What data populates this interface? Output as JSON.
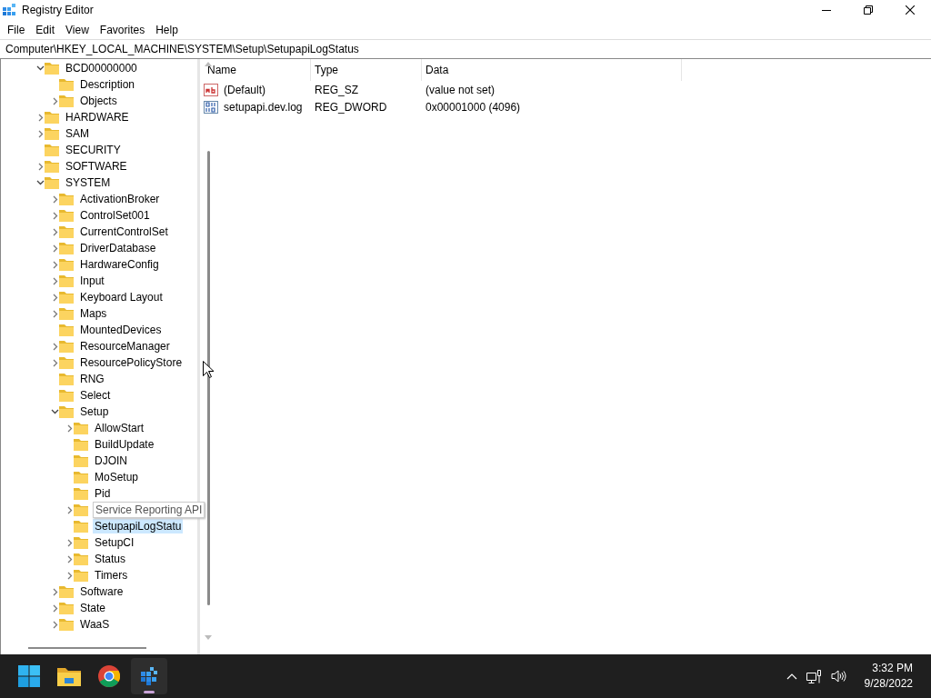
{
  "window": {
    "title": "Registry Editor"
  },
  "menu": [
    "File",
    "Edit",
    "View",
    "Favorites",
    "Help"
  ],
  "address": "Computer\\HKEY_LOCAL_MACHINE\\SYSTEM\\Setup\\SetupapiLogStatus",
  "tree": [
    {
      "label": "BCD00000000",
      "kind": "expanded",
      "selected": false,
      "hovered": false,
      "children": [
        {
          "label": "Description",
          "kind": "leaf",
          "selected": false,
          "hovered": false
        },
        {
          "label": "Objects",
          "kind": "collapsed",
          "selected": false,
          "hovered": false
        }
      ]
    },
    {
      "label": "HARDWARE",
      "kind": "collapsed",
      "selected": false,
      "hovered": false
    },
    {
      "label": "SAM",
      "kind": "collapsed",
      "selected": false,
      "hovered": false
    },
    {
      "label": "SECURITY",
      "kind": "leaf",
      "selected": false,
      "hovered": false
    },
    {
      "label": "SOFTWARE",
      "kind": "collapsed",
      "selected": false,
      "hovered": false
    },
    {
      "label": "SYSTEM",
      "kind": "expanded",
      "selected": false,
      "hovered": false,
      "children": [
        {
          "label": "ActivationBroker",
          "kind": "collapsed",
          "selected": false,
          "hovered": false
        },
        {
          "label": "ControlSet001",
          "kind": "collapsed",
          "selected": false,
          "hovered": false
        },
        {
          "label": "CurrentControlSet",
          "kind": "collapsed",
          "selected": false,
          "hovered": false
        },
        {
          "label": "DriverDatabase",
          "kind": "collapsed",
          "selected": false,
          "hovered": false
        },
        {
          "label": "HardwareConfig",
          "kind": "collapsed",
          "selected": false,
          "hovered": false
        },
        {
          "label": "Input",
          "kind": "collapsed",
          "selected": false,
          "hovered": false
        },
        {
          "label": "Keyboard Layout",
          "kind": "collapsed",
          "selected": false,
          "hovered": false
        },
        {
          "label": "Maps",
          "kind": "collapsed",
          "selected": false,
          "hovered": false
        },
        {
          "label": "MountedDevices",
          "kind": "leaf",
          "selected": false,
          "hovered": false
        },
        {
          "label": "ResourceManager",
          "kind": "collapsed",
          "selected": false,
          "hovered": false
        },
        {
          "label": "ResourcePolicyStore",
          "kind": "collapsed",
          "selected": false,
          "hovered": false
        },
        {
          "label": "RNG",
          "kind": "leaf",
          "selected": false,
          "hovered": false
        },
        {
          "label": "Select",
          "kind": "leaf",
          "selected": false,
          "hovered": false
        },
        {
          "label": "Setup",
          "kind": "expanded",
          "selected": false,
          "hovered": false,
          "children": [
            {
              "label": "AllowStart",
              "kind": "collapsed",
              "selected": false,
              "hovered": false
            },
            {
              "label": "BuildUpdate",
              "kind": "leaf",
              "selected": false,
              "hovered": false
            },
            {
              "label": "DJOIN",
              "kind": "leaf",
              "selected": false,
              "hovered": false
            },
            {
              "label": "MoSetup",
              "kind": "leaf",
              "selected": false,
              "hovered": false
            },
            {
              "label": "Pid",
              "kind": "leaf",
              "selected": false,
              "hovered": false
            },
            {
              "label": "Service Reporting API",
              "kind": "collapsed",
              "selected": false,
              "hovered": true
            },
            {
              "label": "SetupapiLogStatu",
              "kind": "leaf",
              "selected": true,
              "hovered": false
            },
            {
              "label": "SetupCI",
              "kind": "collapsed",
              "selected": false,
              "hovered": false
            },
            {
              "label": "Status",
              "kind": "collapsed",
              "selected": false,
              "hovered": false
            },
            {
              "label": "Timers",
              "kind": "collapsed",
              "selected": false,
              "hovered": false
            }
          ]
        },
        {
          "label": "Software",
          "kind": "collapsed",
          "selected": false,
          "hovered": false
        },
        {
          "label": "State",
          "kind": "collapsed",
          "selected": false,
          "hovered": false
        },
        {
          "label": "WaaS",
          "kind": "collapsed",
          "selected": false,
          "hovered": false
        }
      ]
    }
  ],
  "values": {
    "columns": [
      "Name",
      "Type",
      "Data"
    ],
    "rows": [
      {
        "kind": "string",
        "name": "(Default)",
        "type": "REG_SZ",
        "data": "(value not set)"
      },
      {
        "kind": "binary",
        "name": "setupapi.dev.log",
        "type": "REG_DWORD",
        "data": "0x00001000 (4096)"
      }
    ]
  },
  "taskbar": {
    "apps": [
      {
        "kind": "start",
        "active": false
      },
      {
        "kind": "explorer",
        "active": false
      },
      {
        "kind": "browser",
        "active": false
      },
      {
        "kind": "registry",
        "active": true
      }
    ],
    "time": "3:32 PM",
    "date": "9/28/2022"
  }
}
